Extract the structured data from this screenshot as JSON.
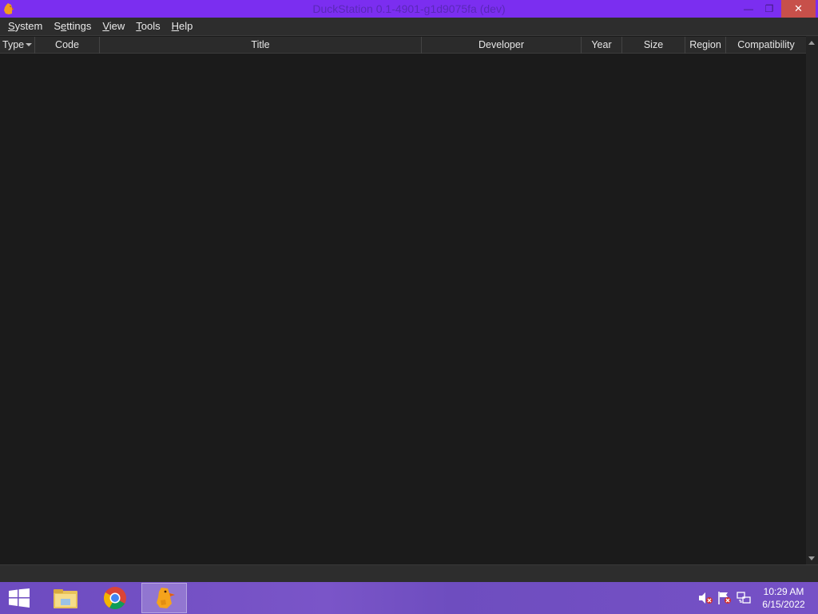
{
  "window": {
    "title": "DuckStation 0.1-4901-g1d9075fa (dev)",
    "minimize_glyph": "—",
    "restore_glyph": "❐",
    "close_glyph": "✕"
  },
  "menu": [
    {
      "label": "System",
      "mnemonic": "S"
    },
    {
      "label": "Settings",
      "mnemonic": "e"
    },
    {
      "label": "View",
      "mnemonic": "V"
    },
    {
      "label": "Tools",
      "mnemonic": "T"
    },
    {
      "label": "Help",
      "mnemonic": "H"
    }
  ],
  "game_list": {
    "columns": [
      "Type",
      "Code",
      "Title",
      "Developer",
      "Year",
      "Size",
      "Region",
      "Compatibility"
    ],
    "sort_column": "Type",
    "rows": []
  },
  "taskbar": {
    "apps": [
      {
        "name": "File Explorer",
        "icon": "folder-icon",
        "active": false
      },
      {
        "name": "Google Chrome",
        "icon": "chrome-icon",
        "active": false
      },
      {
        "name": "DuckStation",
        "icon": "duck-icon",
        "active": true
      }
    ],
    "tray": [
      "volume-muted-icon",
      "action-center-flag-icon",
      "network-icon"
    ],
    "time": "10:29 AM",
    "date": "6/15/2022"
  },
  "colors": {
    "titlebar": "#7b2ef0",
    "taskbar": "#7351c4",
    "list_background": "#1b1b1b",
    "close_button": "#c7504a"
  }
}
